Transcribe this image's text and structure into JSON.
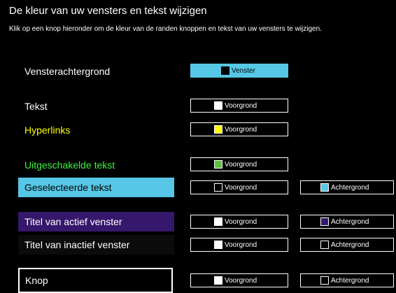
{
  "header": {
    "title": "De kleur van uw vensters en tekst wijzigen",
    "subtitle": "Klik op een knop hieronder om de kleur van de randen knoppen en tekst van uw vensters te wijzigen."
  },
  "colors": {
    "background": "#000000",
    "text": "#ffffff",
    "hyperlink": "#ffff00",
    "disabled_text": "#3ff23f",
    "selection_bg": "#56c7e6",
    "active_title_bg": "#35186b",
    "inactive_title_bg": "#0b0b0b"
  },
  "rows": {
    "window_bg": {
      "label": "Vensterachtergrond",
      "button_label": "Venster"
    },
    "text": {
      "label": "Tekst",
      "button_label": "Voorgrond"
    },
    "hyperlinks": {
      "label": "Hyperlinks",
      "button_label": "Voorgrond"
    },
    "disabled": {
      "label": "Uitgeschakelde tekst",
      "button_label": "Voorgrond"
    },
    "selected": {
      "label": "Geselecteerde tekst",
      "fg_label": "Voorgrond",
      "bg_label": "Achtergrond"
    },
    "active_title": {
      "label": "Titel van actief venster",
      "fg_label": "Voorgrond",
      "bg_label": "Achtergrond"
    },
    "inactive_title": {
      "label": "Titel van inactief venster",
      "fg_label": "Voorgrond",
      "bg_label": "Achtergrond"
    },
    "button": {
      "label": "Knop",
      "fg_label": "Voorgrond",
      "bg_label": "Achtergrond"
    }
  }
}
